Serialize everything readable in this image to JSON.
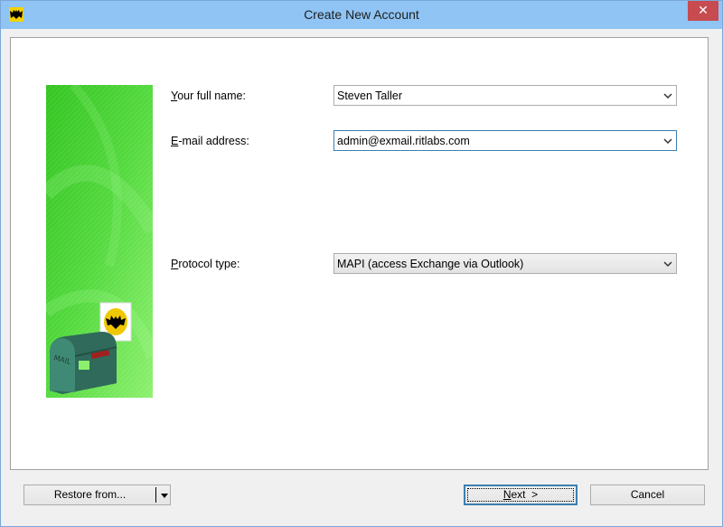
{
  "window": {
    "title": "Create New Account",
    "close_glyph": "✕"
  },
  "form": {
    "full_name": {
      "label_pre": "Y",
      "label_rest": "our full name:",
      "value": "Steven Taller"
    },
    "email": {
      "label_pre": "E",
      "label_rest": "-mail address:",
      "value": "admin@exmail.ritlabs.com"
    },
    "protocol": {
      "label_pre": "P",
      "label_rest": "rotocol type:",
      "value": "MAPI (access Exchange via Outlook)"
    }
  },
  "banner": {
    "mailbox_text": "MAIL",
    "icon": "bat-mailbox-illustration"
  },
  "buttons": {
    "restore": "Restore from...",
    "next_pre": "N",
    "next_rest": "ext  >",
    "cancel": "Cancel"
  },
  "colors": {
    "titlebar": "#8fc4f4",
    "close": "#c74b50",
    "banner_green": "#52d93c"
  }
}
